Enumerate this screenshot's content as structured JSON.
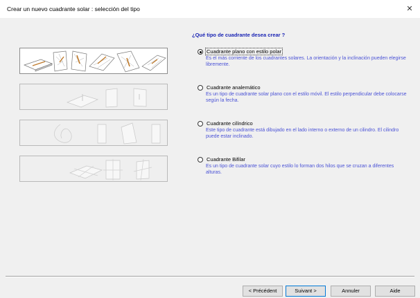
{
  "window": {
    "title": "Crear un nuevo cuadrante solar : selección del tipo",
    "close_glyph": "✕"
  },
  "question": "¿Qué tipo de cuadrante desea crear ?",
  "options": [
    {
      "label": "Cuadrante plano con estilo polar",
      "description": "Es el más corriente de los cuadrantes solares. La orientación y la inclinación pueden elegirse libremente.",
      "checked": true
    },
    {
      "label": "Cuadrante analemático",
      "description": "Es un tipo de cuadrante solar plano con el estilo móvil. El estilo perpendicular debe colocarse según la fecha.",
      "checked": false
    },
    {
      "label": "Cuadrante cilíndrico",
      "description": "Este tipo de cuadrante está dibujado en el lado interno o externo de un cilindro. El cilindro puede estar inclinado.",
      "checked": false
    },
    {
      "label": "Cuadrante Bifilar",
      "description": "Es un tipo de cuadrante solar cuyo estilo lo forman dos hilos que se cruzan a diferentes alturas.",
      "checked": false
    }
  ],
  "buttons": {
    "previous": "< Précédent",
    "next": "Suivant >",
    "cancel": "Annuler",
    "help": "Aide"
  },
  "colors": {
    "question": "#1a24b4",
    "description": "#4a52d6",
    "dialog_background": "#f0f0f0",
    "default_button_border": "#0078d7"
  }
}
